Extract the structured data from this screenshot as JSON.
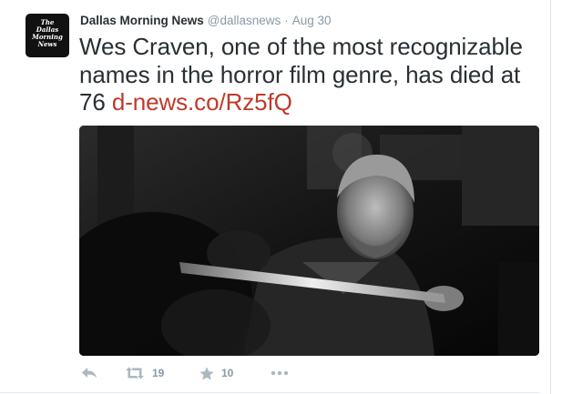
{
  "tweet": {
    "author_name": "Dallas Morning News",
    "handle": "@dallasnews",
    "separator": "·",
    "timestamp": "Aug 30",
    "text": "Wes Craven, one of the most recognizable names in the horror film genre, has died at 76 ",
    "link": "d-news.co/Rz5fQ",
    "avatar_logo_lines": [
      "The",
      "Dallas",
      "Morning",
      "News"
    ],
    "media_description_icon": "black-and-white-photo"
  },
  "actions": {
    "reply_icon": "reply-icon",
    "retweet_icon": "retweet-icon",
    "retweet_count": "19",
    "favorite_icon": "star-icon",
    "favorite_count": "10",
    "more_icon": "more-icon"
  },
  "colors": {
    "link": "#c0392b",
    "text": "#292f33",
    "muted": "#8899a6",
    "icon": "#aab8c2"
  }
}
